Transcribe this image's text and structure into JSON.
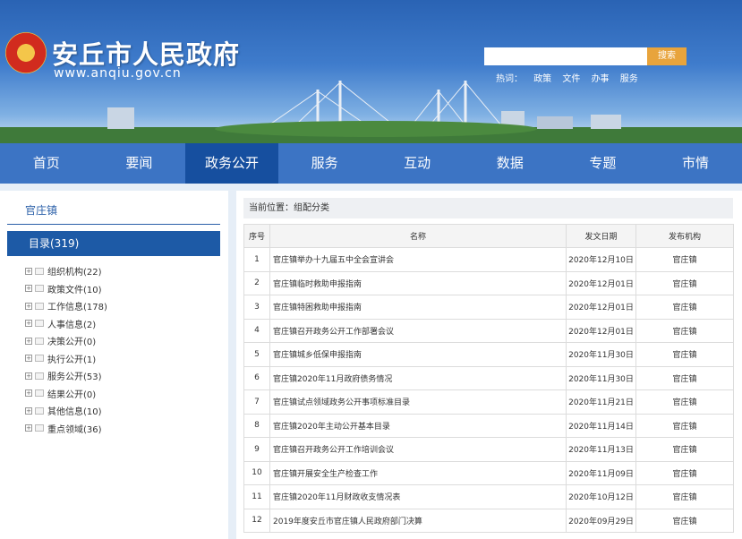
{
  "header": {
    "site_title": "安丘市人民政府",
    "site_url": "www.anqiu.gov.cn",
    "search_button": "搜索",
    "hot_label": "热词：",
    "hot_words": [
      "政策",
      "文件",
      "办事",
      "服务"
    ]
  },
  "nav": [
    "首页",
    "要闻",
    "政务公开",
    "服务",
    "互动",
    "数据",
    "专题",
    "市情"
  ],
  "nav_active": "政务公开",
  "sidebar": {
    "town": "官庄镇",
    "catalog": "目录(319)",
    "items": [
      "组织机构(22)",
      "政策文件(10)",
      "工作信息(178)",
      "人事信息(2)",
      "决策公开(0)",
      "执行公开(1)",
      "服务公开(53)",
      "结果公开(0)",
      "其他信息(10)",
      "重点领域(36)"
    ]
  },
  "main": {
    "breadcrumb": "当前位置：组配分类",
    "columns": [
      "序号",
      "名称",
      "发文日期",
      "发布机构"
    ],
    "rows": [
      {
        "no": "1",
        "title": "官庄镇举办十九届五中全会宣讲会",
        "date": "2020年12月10日",
        "org": "官庄镇"
      },
      {
        "no": "2",
        "title": "官庄镇临时救助申报指南",
        "date": "2020年12月01日",
        "org": "官庄镇"
      },
      {
        "no": "3",
        "title": "官庄镇特困救助申报指南",
        "date": "2020年12月01日",
        "org": "官庄镇"
      },
      {
        "no": "4",
        "title": "官庄镇召开政务公开工作部署会议",
        "date": "2020年12月01日",
        "org": "官庄镇"
      },
      {
        "no": "5",
        "title": "官庄镇城乡低保申报指南",
        "date": "2020年11月30日",
        "org": "官庄镇"
      },
      {
        "no": "6",
        "title": "官庄镇2020年11月政府债务情况",
        "date": "2020年11月30日",
        "org": "官庄镇"
      },
      {
        "no": "7",
        "title": "官庄镇试点领域政务公开事项标准目录",
        "date": "2020年11月21日",
        "org": "官庄镇"
      },
      {
        "no": "8",
        "title": "官庄镇2020年主动公开基本目录",
        "date": "2020年11月14日",
        "org": "官庄镇"
      },
      {
        "no": "9",
        "title": "官庄镇召开政务公开工作培训会议",
        "date": "2020年11月13日",
        "org": "官庄镇"
      },
      {
        "no": "10",
        "title": "官庄镇开展安全生产检查工作",
        "date": "2020年11月09日",
        "org": "官庄镇"
      },
      {
        "no": "11",
        "title": "官庄镇2020年11月财政收支情况表",
        "date": "2020年10月12日",
        "org": "官庄镇"
      },
      {
        "no": "12",
        "title": "2019年度安丘市官庄镇人民政府部门决算",
        "date": "2020年09月29日",
        "org": "官庄镇"
      }
    ]
  }
}
